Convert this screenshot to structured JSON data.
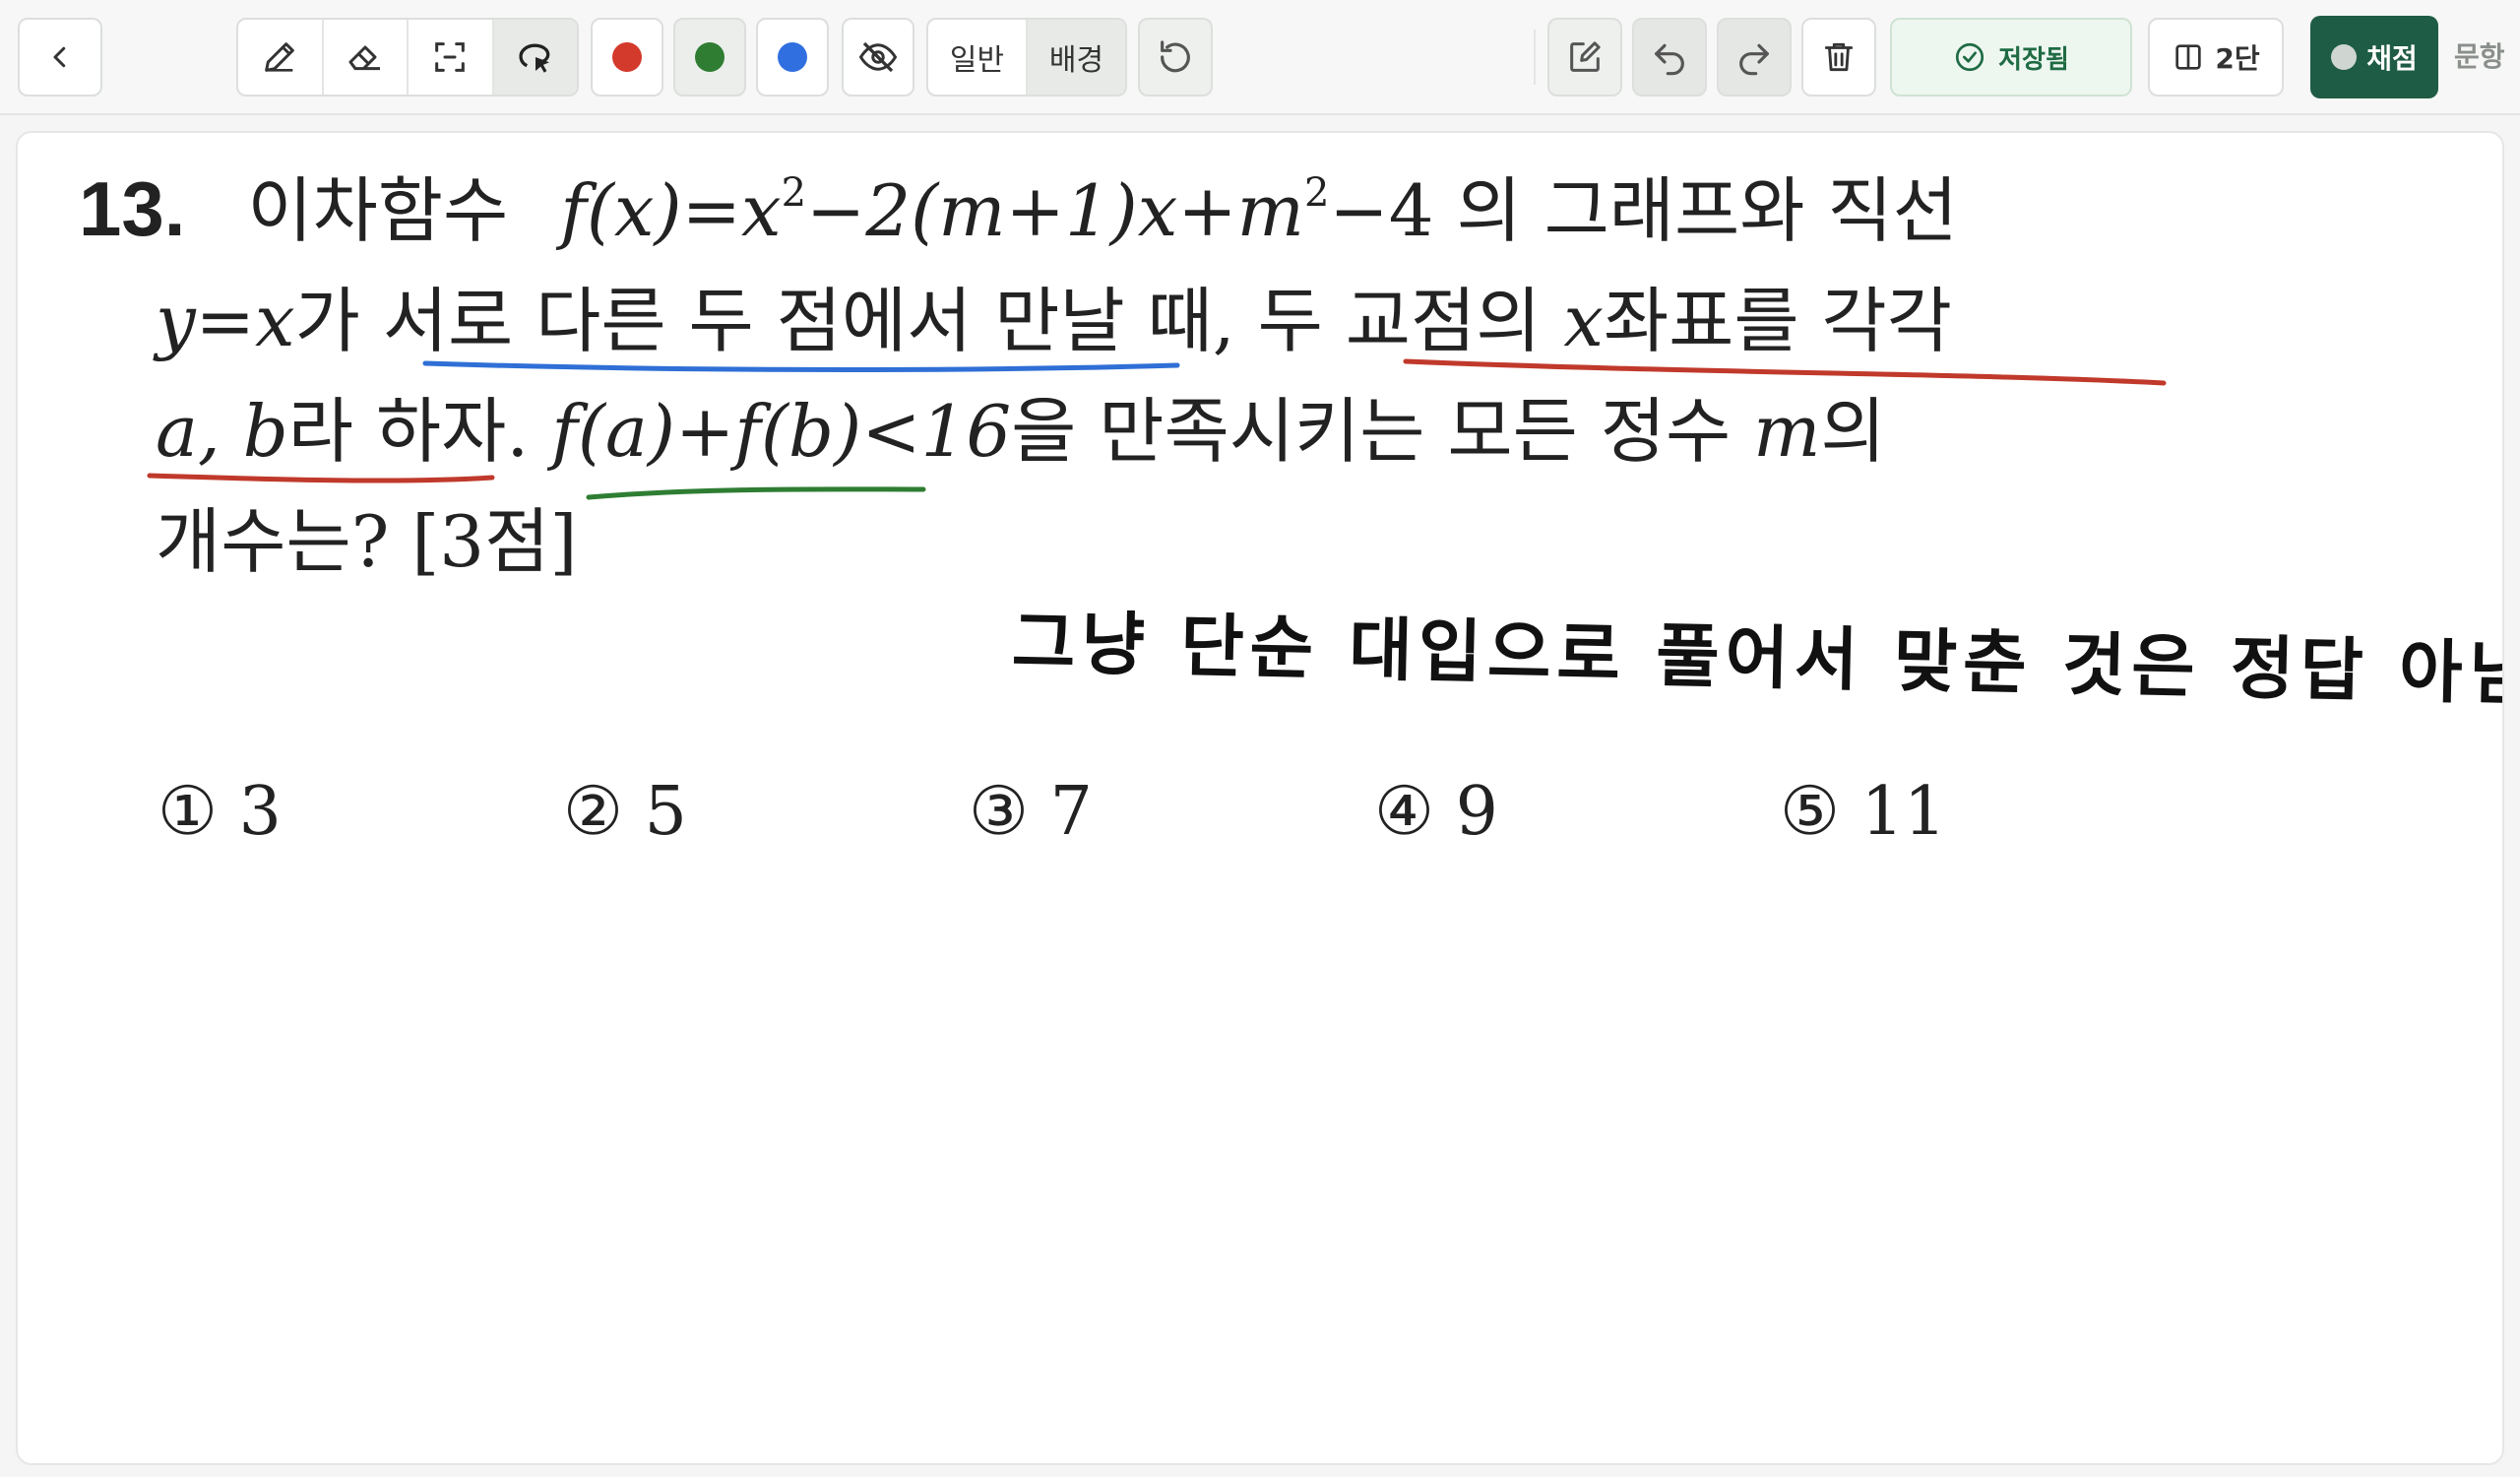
{
  "toolbar": {
    "mode_normal": "일반",
    "mode_background": "배경",
    "saved_label": "저장됨",
    "columns_label": "2단",
    "grade_label": "채점",
    "next_label": "문항"
  },
  "pen_colors": [
    "#d33a2c",
    "#2e7d32",
    "#2f6fe0"
  ],
  "question": {
    "number": "13.",
    "line1_prefix": "이차함수",
    "line1_math": "f(x)=x",
    "line1_math2": "−2(m+1)x+m",
    "line1_math3": "−4",
    "line1_suffix": "의 그래프와 직선",
    "sup2": "2",
    "line2_math": "y=x",
    "line2_text": "가 서로 다른 두 점에서 만날 때, 두 교점의",
    "line2_var": "x",
    "line2_text2": "좌표를 각각",
    "line3_vars": "a, b",
    "line3_text": "라 하자.",
    "line3_math": "f(a)+f(b)<16",
    "line3_text2": "을 만족시키는 모든 정수",
    "line3_var": "m",
    "line3_text3": "의",
    "line4_text": "개수는? [3점]"
  },
  "choices": [
    {
      "mark": "①",
      "value": "3"
    },
    {
      "mark": "②",
      "value": "5"
    },
    {
      "mark": "③",
      "value": "7"
    },
    {
      "mark": "④",
      "value": "9"
    },
    {
      "mark": "⑤",
      "value": "11"
    }
  ],
  "handwritten_note": "그냥 단순 대입으로 풀어서 맞춘 것은 정답 아님!",
  "annotation_colors": {
    "blue": "#2f6fd6",
    "red": "#c0392b",
    "green": "#2e7d32"
  }
}
